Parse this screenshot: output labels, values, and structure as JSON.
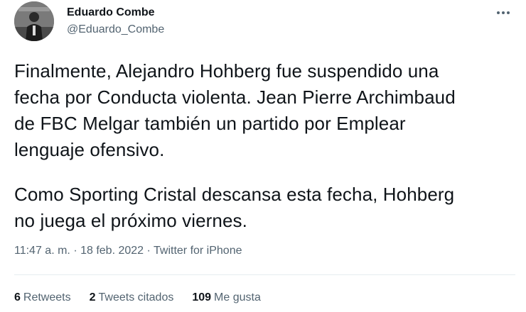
{
  "author": {
    "name": "Eduardo Combe",
    "handle": "@Eduardo_Combe"
  },
  "tweet": {
    "paragraphs": [
      "Finalmente, Alejandro Hohberg fue suspendido una\nfecha por Conducta violenta. Jean Pierre Archimbaud\nde FBC Melgar también un partido por Emplear\nlenguaje ofensivo.",
      "Como Sporting Cristal descansa esta fecha, Hohberg\nno juega el próximo viernes."
    ],
    "time": "11:47 a. m.",
    "separator": "·",
    "date": "18 feb. 2022",
    "source": "Twitter for iPhone"
  },
  "stats": {
    "retweets_count": "6",
    "retweets_label": "Retweets",
    "quotes_count": "2",
    "quotes_label": "Tweets citados",
    "likes_count": "109",
    "likes_label": "Me gusta"
  },
  "icons": {
    "more": "more-dots-icon"
  },
  "colors": {
    "text": "#0f1419",
    "secondary": "#536471",
    "divider": "#e6ecf0"
  }
}
